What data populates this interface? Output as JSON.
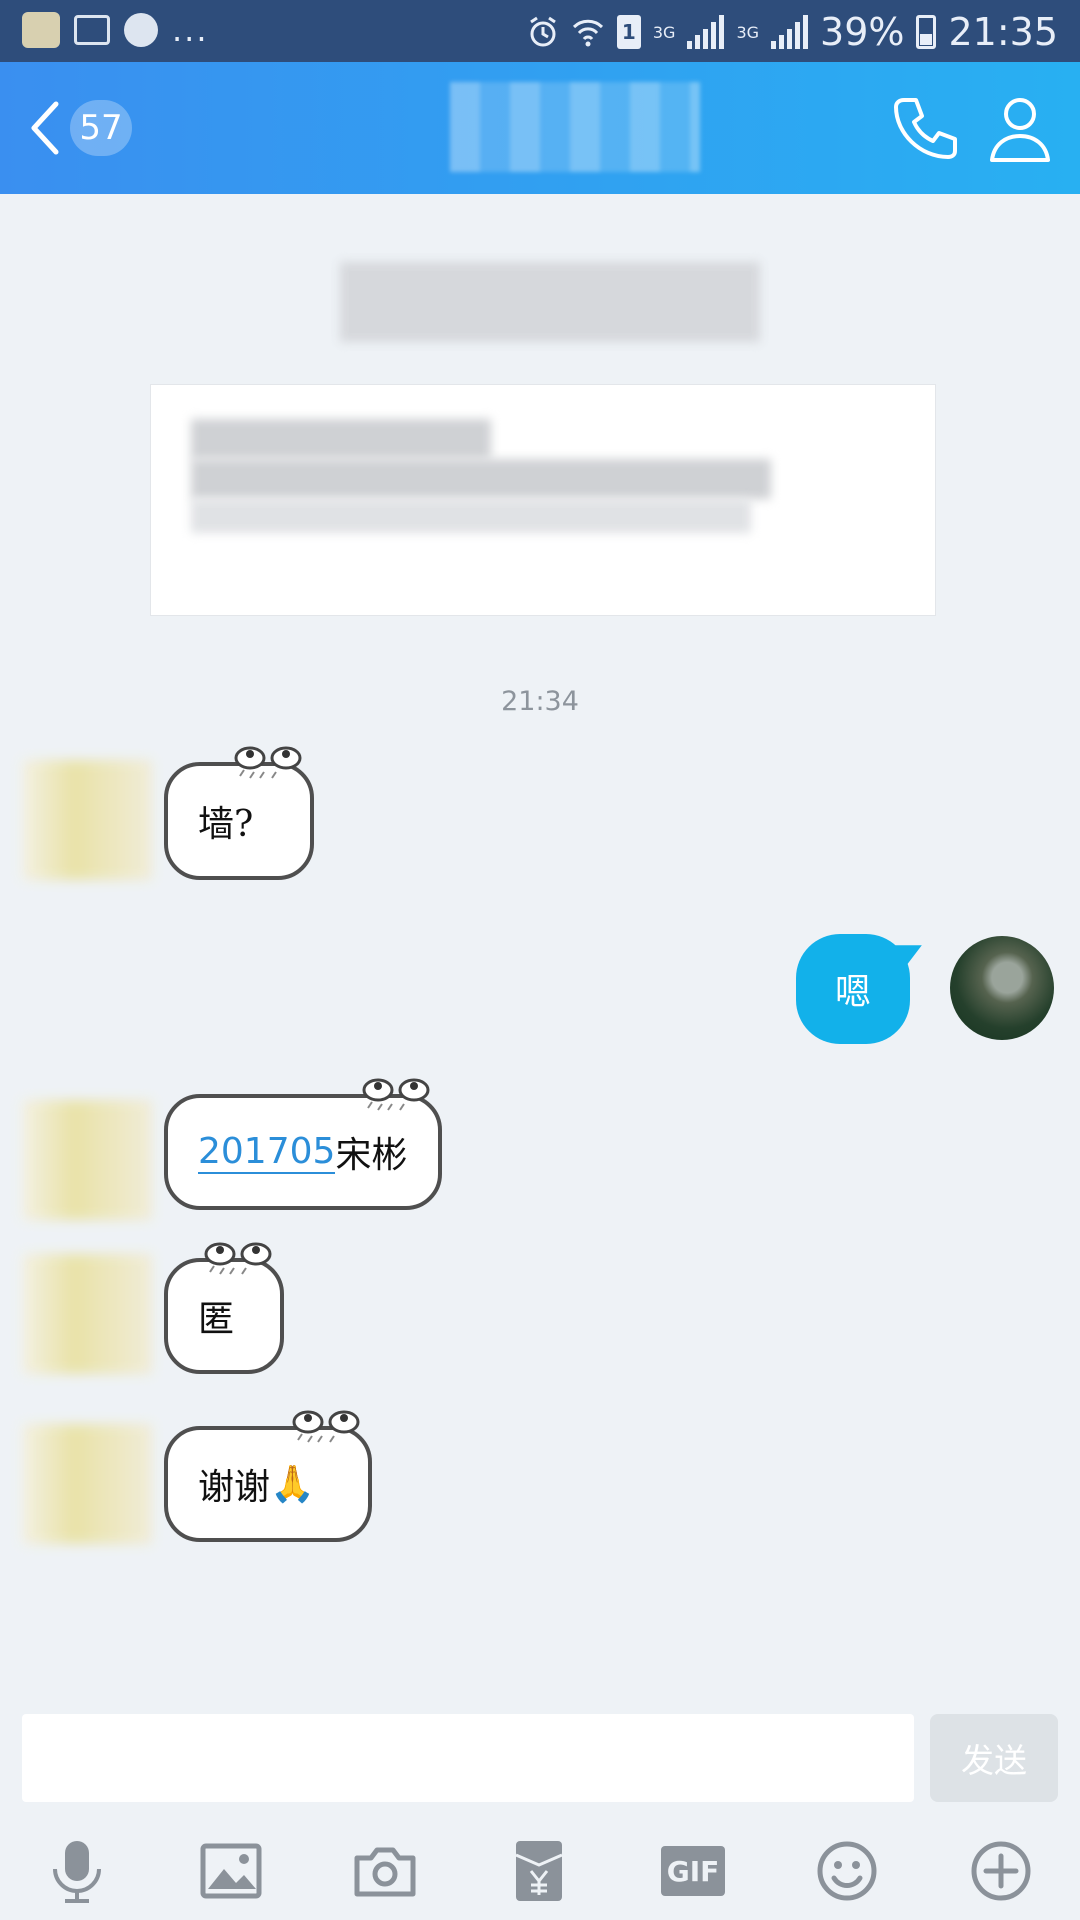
{
  "status_bar": {
    "dots": "...",
    "net1": "3G",
    "net2": "3G",
    "sim": "1",
    "battery": "39%",
    "time": "21:35"
  },
  "header": {
    "back_badge": "57",
    "icons": [
      "chevron-left-icon",
      "phone-icon",
      "person-icon"
    ]
  },
  "chat": {
    "timestamp": "21:34",
    "messages": [
      {
        "side": "left",
        "text": "墙?"
      },
      {
        "side": "right",
        "text": "嗯"
      },
      {
        "side": "left",
        "link": "201705",
        "text": "宋彬"
      },
      {
        "side": "left",
        "text": "匿"
      },
      {
        "side": "left",
        "text": "谢谢",
        "emoji": "🙏"
      }
    ]
  },
  "composer": {
    "send_label": "发送",
    "tools": [
      "microphone-icon",
      "image-icon",
      "camera-icon",
      "red-packet-icon",
      "gif-icon",
      "emoji-icon",
      "plus-icon"
    ],
    "gif_label": "GIF"
  },
  "colors": {
    "status_bar": "#2e4d7b",
    "header_start": "#3a8ff0",
    "header_end": "#28b0f2",
    "outgoing_bubble": "#12b1ea",
    "background": "#eef2f6"
  }
}
